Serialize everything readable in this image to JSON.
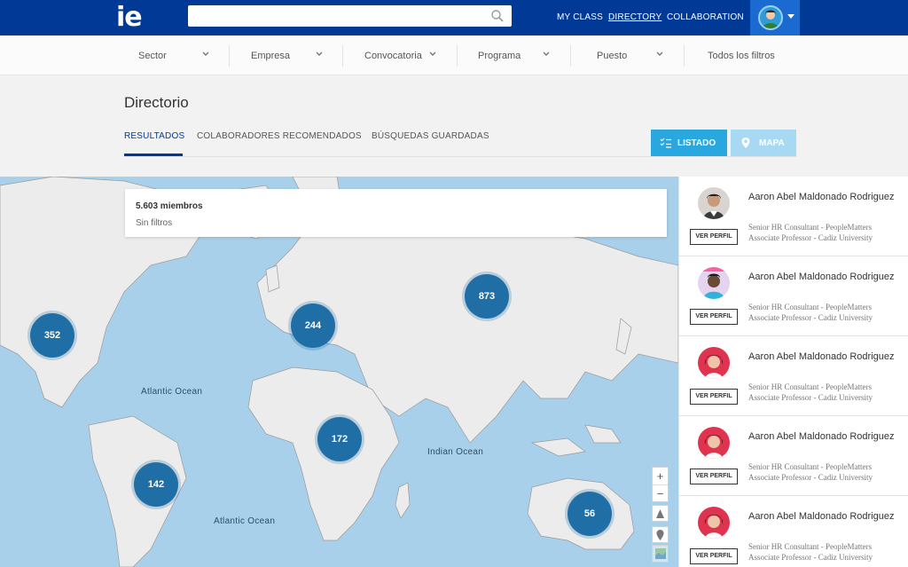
{
  "header": {
    "logo": "ie",
    "search": {
      "value": "",
      "placeholder": ""
    },
    "nav": [
      "MY CLASS",
      "DIRECTORY",
      "COLLABORATION"
    ],
    "active_nav": "DIRECTORY"
  },
  "filters": [
    "Sector",
    "Empresa",
    "Convocatoria",
    "Programa",
    "Puesto",
    "Todos los filtros"
  ],
  "page": {
    "title": "Directorio",
    "tabs": [
      "RESULTADOS",
      "COLABORADORES RECOMENDADOS",
      "BÚSQUEDAS GUARDADAS"
    ],
    "active_tab": "RESULTADOS",
    "view_buttons": {
      "list": "LISTADO",
      "map": "MAPA"
    }
  },
  "map": {
    "summary": {
      "count": "5.603 miembros",
      "filters": "Sin filtros"
    },
    "oceans": [
      "Atlantic Ocean",
      "Atlantic Ocean",
      "Indian Ocean"
    ],
    "clusters": [
      "352",
      "244",
      "873",
      "172",
      "142",
      "56"
    ],
    "controls": [
      "+",
      "−"
    ]
  },
  "results": [
    {
      "name": "Aaron Abel Maldonado Rodriguez",
      "role1": "Senior HR Consultant - PeopleMatters",
      "role2": "Associate Professor - Cadiz University",
      "button": "VER PERFIL"
    },
    {
      "name": "Aaron Abel Maldonado Rodriguez",
      "role1": "Senior HR Consultant - PeopleMatters",
      "role2": "Associate Professor - Cadiz University",
      "button": "VER PERFIL"
    },
    {
      "name": "Aaron Abel Maldonado Rodriguez",
      "role1": "Senior HR Consultant - PeopleMatters",
      "role2": "Associate Professor - Cadiz University",
      "button": "VER PERFIL"
    },
    {
      "name": "Aaron Abel Maldonado Rodriguez",
      "role1": "Senior HR Consultant - PeopleMatters",
      "role2": "Associate Professor - Cadiz University",
      "button": "VER PERFIL"
    },
    {
      "name": "Aaron Abel Maldonado Rodriguez",
      "role1": "Senior HR Consultant - PeopleMatters",
      "role2": "Associate Professor - Cadiz University",
      "button": "VER PERFIL"
    }
  ],
  "colors": {
    "brand": "#003a96",
    "accent": "#29a8e0",
    "cluster": "#1f6fa6",
    "ocean": "#a8d0ea"
  }
}
